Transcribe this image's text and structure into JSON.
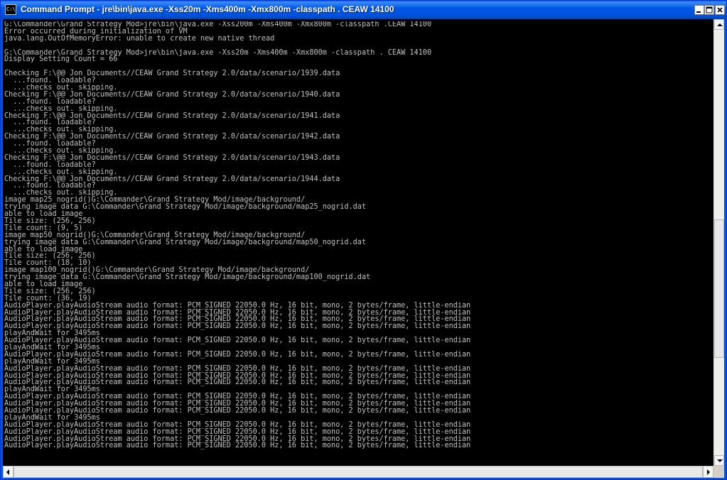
{
  "window": {
    "title": "Command Prompt - jre\\bin\\java.exe -Xss20m -Xms400m -Xmx800m -classpath . CEAW 14100",
    "icon_label": "C:\\",
    "controls": [
      "minimize-icon",
      "maximize-icon",
      "close-icon"
    ]
  },
  "console": {
    "text_color": "#c0c0c0",
    "background": "#000000",
    "lines": [
      "G:\\Commander\\Grand Strategy Mod>jre\\bin\\java.exe -Xss200m -Xms400m -Xmx800m -classpath .CEAW 14100",
      "Error occurred during initialization of VM",
      "java.lang.OutOfMemoryError: unable to create new native thread",
      "",
      "G:\\Commander\\Grand Strategy Mod>jre\\bin\\java.exe -Xss20m -Xms400m -Xmx800m -classpath . CEAW 14100",
      "Display Setting Count = 66",
      "",
      "Checking F:\\@@ Jon Documents//CEAW Grand Strategy 2.0/data/scenario/1939.data",
      "  ...found. loadable?",
      "  ...checks out. skipping.",
      "Checking F:\\@@ Jon Documents//CEAW Grand Strategy 2.0/data/scenario/1940.data",
      "  ...found. loadable?",
      "  ...checks out. skipping.",
      "Checking F:\\@@ Jon Documents//CEAW Grand Strategy 2.0/data/scenario/1941.data",
      "  ...found. loadable?",
      "  ...checks out. skipping.",
      "Checking F:\\@@ Jon Documents//CEAW Grand Strategy 2.0/data/scenario/1942.data",
      "  ...found. loadable?",
      "  ...checks out. skipping.",
      "Checking F:\\@@ Jon Documents//CEAW Grand Strategy 2.0/data/scenario/1943.data",
      "  ...found. loadable?",
      "  ...checks out. skipping.",
      "Checking F:\\@@ Jon Documents//CEAW Grand Strategy 2.0/data/scenario/1944.data",
      "  ...found. loadable?",
      "  ...checks out. skipping.",
      "image map25_nogrid()G:\\Commander\\Grand Strategy Mod/image/background/",
      "trying image data G:\\Commander\\Grand Strategy Mod/image/background/map25_nogrid.dat",
      "able to load image",
      "Tile size: (256, 256)",
      "Tile count: (9, 5)",
      "image map50_nogrid()G:\\Commander\\Grand Strategy Mod/image/background/",
      "trying image data G:\\Commander\\Grand Strategy Mod/image/background/map50_nogrid.dat",
      "able to load image",
      "Tile size: (256, 256)",
      "Tile count: (18, 10)",
      "image map100_nogrid()G:\\Commander\\Grand Strategy Mod/image/background/",
      "trying image data G:\\Commander\\Grand Strategy Mod/image/background/map100_nogrid.dat",
      "able to load image",
      "Tile size: (256, 256)",
      "Tile count: (36, 19)",
      "AudioPlayer.playAudioStream audio format: PCM_SIGNED 22050.0 Hz, 16 bit, mono, 2 bytes/frame, little-endian",
      "AudioPlayer.playAudioStream audio format: PCM_SIGNED 22050.0 Hz, 16 bit, mono, 2 bytes/frame, little-endian",
      "AudioPlayer.playAudioStream audio format: PCM_SIGNED 22050.0 Hz, 16 bit, mono, 2 bytes/frame, little-endian",
      "AudioPlayer.playAudioStream audio format: PCM_SIGNED 22050.0 Hz, 16 bit, mono, 2 bytes/frame, little-endian",
      "playAndWait for 3495ms",
      "AudioPlayer.playAudioStream audio format: PCM_SIGNED 22050.0 Hz, 16 bit, mono, 2 bytes/frame, little-endian",
      "playAndWait for 3495ms",
      "AudioPlayer.playAudioStream audio format: PCM_SIGNED 22050.0 Hz, 16 bit, mono, 2 bytes/frame, little-endian",
      "playAndWait for 3495ms",
      "AudioPlayer.playAudioStream audio format: PCM_SIGNED 22050.0 Hz, 16 bit, mono, 2 bytes/frame, little-endian",
      "AudioPlayer.playAudioStream audio format: PCM_SIGNED 22050.0 Hz, 16 bit, mono, 2 bytes/frame, little-endian",
      "AudioPlayer.playAudioStream audio format: PCM_SIGNED 22050.0 Hz, 16 bit, mono, 2 bytes/frame, little-endian",
      "playAndWait for 3495ms",
      "AudioPlayer.playAudioStream audio format: PCM_SIGNED 22050.0 Hz, 16 bit, mono, 2 bytes/frame, little-endian",
      "AudioPlayer.playAudioStream audio format: PCM_SIGNED 22050.0 Hz, 16 bit, mono, 2 bytes/frame, little-endian",
      "AudioPlayer.playAudioStream audio format: PCM_SIGNED 22050.0 Hz, 16 bit, mono, 2 bytes/frame, little-endian",
      "playAndWait for 3495ms",
      "AudioPlayer.playAudioStream audio format: PCM_SIGNED 22050.0 Hz, 16 bit, mono, 2 bytes/frame, little-endian",
      "AudioPlayer.playAudioStream audio format: PCM_SIGNED 22050.0 Hz, 16 bit, mono, 2 bytes/frame, little-endian",
      "AudioPlayer.playAudioStream audio format: PCM_SIGNED 22050.0 Hz, 16 bit, mono, 2 bytes/frame, little-endian",
      "AudioPlayer.playAudioStream audio format: PCM_SIGNED 22050.0 Hz, 16 bit, mono, 2 bytes/frame, little-endian"
    ]
  },
  "scrollbars": {
    "vertical_position": 0.66,
    "horizontal_position": 0.0
  }
}
